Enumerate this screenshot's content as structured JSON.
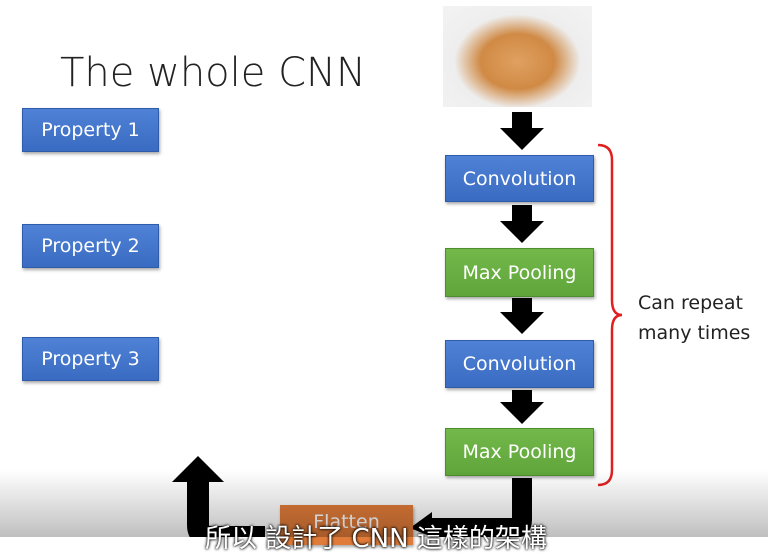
{
  "slide": {
    "title": "The whole CNN",
    "properties": [
      "Property 1",
      "Property 2",
      "Property 3"
    ],
    "layers": [
      "Convolution",
      "Max Pooling",
      "Convolution",
      "Max Pooling"
    ],
    "flatten": "Flatten",
    "note_line1": "Can repeat",
    "note_line2": "many times"
  },
  "subtitle": "所以 設計了 CNN 這樣的架構",
  "colors": {
    "blue": "#4472c4",
    "green": "#70ad47",
    "orange": "#e07b39",
    "bracket": "#e02020"
  }
}
